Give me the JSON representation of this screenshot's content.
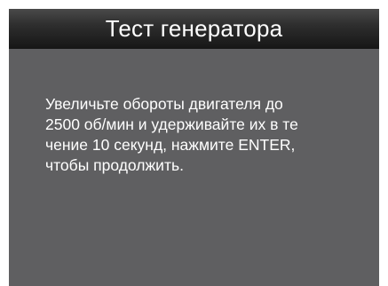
{
  "header": {
    "title": "Тест генератора"
  },
  "main": {
    "message": "Увеличьте обороты двигателя до\n2500 об/мин и удерживайте их в те\nчение 10 секунд, нажмите ENTER,\nчтобы продолжить."
  },
  "colors": {
    "screen_background": "#5f5f61",
    "title_bar": "#222222",
    "text": "#ffffff"
  }
}
